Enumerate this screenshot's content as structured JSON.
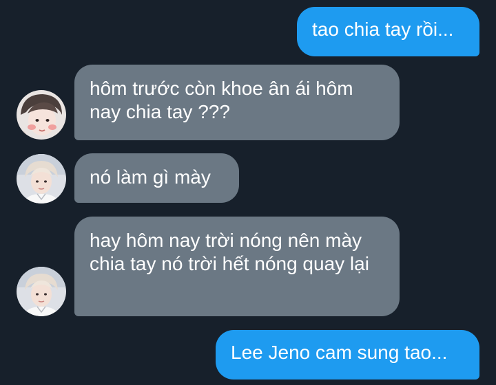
{
  "conversation": {
    "messages": [
      {
        "direction": "outgoing",
        "text": "tao chia tay rồi..."
      },
      {
        "direction": "incoming",
        "text": "hôm trước còn khoe ân ái hôm nay chia tay ???",
        "avatar": "profile-photo-1"
      },
      {
        "direction": "incoming",
        "text": "nó làm gì mày",
        "avatar": "profile-photo-2"
      },
      {
        "direction": "incoming",
        "text": "hay hôm nay trời nóng nên mày chia tay nó trời hết nóng quay lại",
        "avatar": "profile-photo-2"
      },
      {
        "direction": "outgoing",
        "text": "Lee Jeno cam sung tao..."
      }
    ]
  },
  "colors": {
    "background": "#17202b",
    "outgoing_bubble": "#1e9bf0",
    "incoming_bubble": "#6b7884",
    "text": "#ffffff"
  }
}
